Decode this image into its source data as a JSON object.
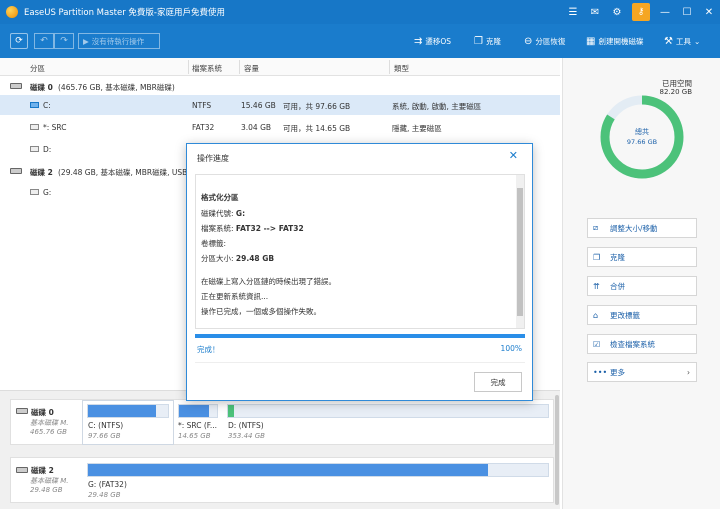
{
  "window": {
    "title": "EaseUS Partition Master 免費版-家庭用戶免費使用",
    "icons": [
      "menu-icon",
      "mail-icon",
      "settings-icon",
      "key-icon",
      "minimize-icon",
      "maximize-icon",
      "close-icon"
    ]
  },
  "toolbar": {
    "refresh_icon": "refresh-icon",
    "execute_label": "沒有待執行操作",
    "items": [
      {
        "label": "遷移OS",
        "icon": "migrate-icon"
      },
      {
        "label": "克隆",
        "icon": "clone-icon"
      },
      {
        "label": "分區恢復",
        "icon": "recover-icon"
      },
      {
        "label": "創建開機磁碟",
        "icon": "bootdisk-icon"
      },
      {
        "label": "工具",
        "icon": "tools-icon"
      }
    ]
  },
  "columns": {
    "partition": "分區",
    "fs": "檔案系統",
    "capacity": "容量",
    "type": "類型"
  },
  "disks": [
    {
      "label": "磁碟 0",
      "info": "(465.76 GB, 基本磁碟, MBR磁碟)",
      "partitions": [
        {
          "name": "C:",
          "fs": "NTFS",
          "used": "15.46 GB",
          "capacity": "可用，共  97.66 GB",
          "type": "系統, 啟動, 啟動, 主要磁區"
        },
        {
          "name": "*: SRC",
          "fs": "FAT32",
          "used": "3.04 GB",
          "capacity": "可用，共  14.65 GB",
          "type": "隱藏, 主要磁區"
        },
        {
          "name": "D:",
          "fs": "",
          "used": "",
          "capacity": "",
          "type": ""
        }
      ]
    },
    {
      "label": "磁碟 2",
      "info": "(29.48 GB, 基本磁碟, MBR磁碟, USB)",
      "partitions": [
        {
          "name": "G:",
          "fs": "",
          "used": "",
          "capacity": "",
          "type": ""
        }
      ]
    }
  ],
  "right_panel": {
    "used_label": "已用空間",
    "used_value": "82.20 GB",
    "center_label": "總共",
    "center_value": "97.66 GB",
    "used_fraction": 0.84,
    "actions": [
      {
        "label": "調整大小/移動",
        "icon": "resize-icon",
        "chevron": ""
      },
      {
        "label": "克隆",
        "icon": "clone-icon",
        "chevron": ""
      },
      {
        "label": "合併",
        "icon": "merge-icon",
        "chevron": ""
      },
      {
        "label": "更改標籤",
        "icon": "tag-icon",
        "chevron": ""
      },
      {
        "label": "檢查檔案系統",
        "icon": "check-icon",
        "chevron": ""
      },
      {
        "label": "更多",
        "icon": "more-icon",
        "chevron": "›"
      }
    ]
  },
  "disk_map": {
    "disk0": {
      "name": "磁碟 0",
      "type": "基本磁碟 M.",
      "size": "465.76 GB",
      "parts": [
        {
          "label": "C: (NTFS)",
          "size": "97.66 GB",
          "fill": 0.85
        },
        {
          "label": "*: SRC (F...",
          "size": "14.65 GB",
          "fill": 0.8
        },
        {
          "label": "D: (NTFS)",
          "size": "353.44 GB",
          "fill": 0.02
        }
      ]
    },
    "disk2": {
      "name": "磁碟 2",
      "type": "基本磁碟 M.",
      "size": "29.48 GB",
      "parts": [
        {
          "label": "G: (FAT32)",
          "size": "29.48 GB",
          "fill": 0.87
        }
      ]
    }
  },
  "dialog": {
    "title": "操作進度",
    "heading": "格式化分區",
    "drive_label": "磁碟代號:",
    "drive_value": "G:",
    "fs_label": "檔案系統:",
    "fs_value": "FAT32 --> FAT32",
    "vol_label": "卷標籤:",
    "size_label": "分區大小:",
    "size_value": "29.48 GB",
    "msg1": "在磁碟上寫入分區鏈的時候出現了錯誤。",
    "msg2": "正在更新系統資訊...",
    "msg3": "操作已完成，一個或多個操作失敗。",
    "status": "完成！",
    "percent_text": "100%",
    "progress": 1.0,
    "done_label": "完成"
  },
  "colors": {
    "accent": "#1a7ccc",
    "donut_used": "#4cc27a",
    "donut_free": "#e3ecf4"
  }
}
